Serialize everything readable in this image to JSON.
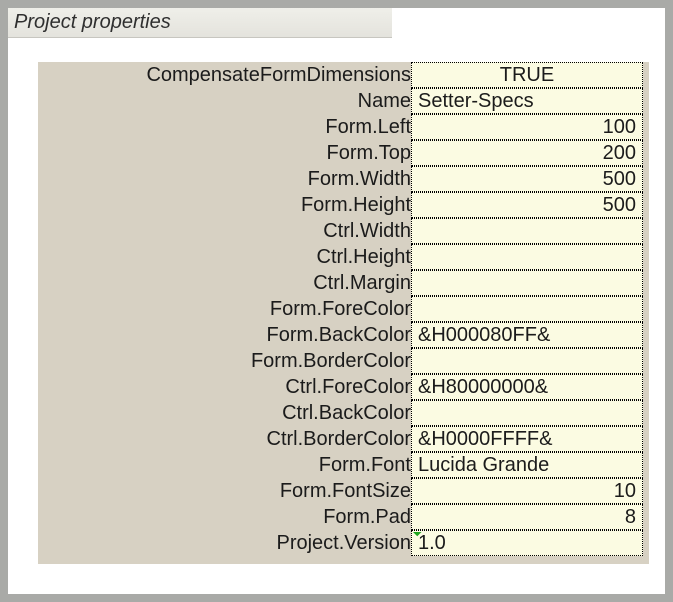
{
  "header": {
    "title": "Project properties"
  },
  "rows": [
    {
      "label": "CompensateFormDimensions",
      "value": "TRUE",
      "align": "center",
      "caret": false
    },
    {
      "label": "Name",
      "value": "Setter-Specs",
      "align": "left",
      "caret": false
    },
    {
      "label": "Form.Left",
      "value": "100",
      "align": "right",
      "caret": false
    },
    {
      "label": "Form.Top",
      "value": "200",
      "align": "right",
      "caret": false
    },
    {
      "label": "Form.Width",
      "value": "500",
      "align": "right",
      "caret": false
    },
    {
      "label": "Form.Height",
      "value": "500",
      "align": "right",
      "caret": false
    },
    {
      "label": "Ctrl.Width",
      "value": "",
      "align": "right",
      "caret": false
    },
    {
      "label": "Ctrl.Height",
      "value": "",
      "align": "right",
      "caret": false
    },
    {
      "label": "Ctrl.Margin",
      "value": "",
      "align": "right",
      "caret": false
    },
    {
      "label": "Form.ForeColor",
      "value": "",
      "align": "left",
      "caret": false
    },
    {
      "label": "Form.BackColor",
      "value": "&H000080FF&",
      "align": "left",
      "caret": false
    },
    {
      "label": "Form.BorderColor",
      "value": "",
      "align": "left",
      "caret": false
    },
    {
      "label": "Ctrl.ForeColor",
      "value": "&H80000000&",
      "align": "left",
      "caret": false
    },
    {
      "label": "Ctrl.BackColor",
      "value": "",
      "align": "left",
      "caret": false
    },
    {
      "label": "Ctrl.BorderColor",
      "value": "&H0000FFFF&",
      "align": "left",
      "caret": false
    },
    {
      "label": "Form.Font",
      "value": "Lucida Grande",
      "align": "left",
      "caret": false
    },
    {
      "label": "Form.FontSize",
      "value": "10",
      "align": "right",
      "caret": false
    },
    {
      "label": "Form.Pad",
      "value": "8",
      "align": "right",
      "caret": false
    },
    {
      "label": "Project.Version",
      "value": "1.0",
      "align": "left",
      "caret": true
    }
  ]
}
